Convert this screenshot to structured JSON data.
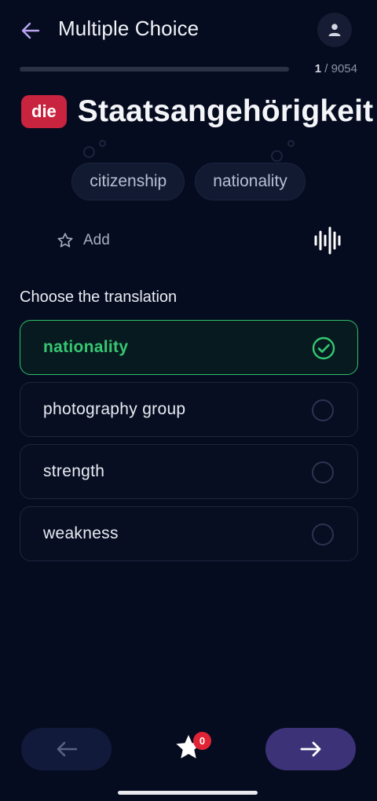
{
  "header": {
    "title": "Multiple Choice"
  },
  "progress": {
    "current": "1",
    "separator": " / ",
    "total": "9054",
    "fraction": 0.0001
  },
  "word": {
    "article": "die",
    "text": "Staatsangehörigkeit"
  },
  "chips": [
    "citizenship",
    "nationality"
  ],
  "actions": {
    "add_label": "Add"
  },
  "question": {
    "prompt": "Choose the translation",
    "options": [
      {
        "label": "nationality",
        "selected": true
      },
      {
        "label": "photography group",
        "selected": false
      },
      {
        "label": "strength",
        "selected": false
      },
      {
        "label": "weakness",
        "selected": false
      }
    ]
  },
  "bottom": {
    "favorites_count": "0"
  },
  "colors": {
    "background": "#060c1f",
    "accent": "#5f5ad6",
    "article_badge": "#c8243f",
    "correct": "#36c872",
    "badge": "#e12336"
  },
  "icons": {
    "back": "arrow-left-icon",
    "profile": "user-icon",
    "add": "star-outline-icon",
    "audio": "sound-wave-icon",
    "check": "check-circle-icon",
    "prev": "arrow-left-icon",
    "next": "arrow-right-icon",
    "favorites": "star-icon"
  }
}
